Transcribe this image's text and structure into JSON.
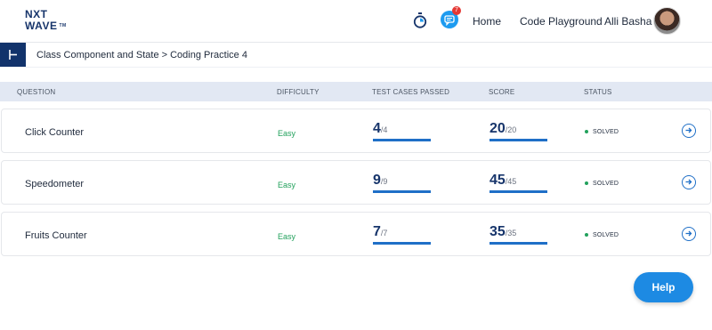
{
  "brand": {
    "line1": "NXT",
    "line2": "WAVE",
    "tm": "TM"
  },
  "nav": {
    "notification_count": "7",
    "home": "Home",
    "playground": "Code Playground",
    "user_name": "Alli Basha"
  },
  "breadcrumb": "Class Component and State > Coding Practice 4",
  "table": {
    "headers": [
      "QUESTION",
      "DIFFICULTY",
      "TEST CASES PASSED",
      "SCORE",
      "STATUS"
    ],
    "rows": [
      {
        "question": "Click Counter",
        "difficulty": "Easy",
        "tests_passed": "4",
        "tests_total": "/4",
        "score": "20",
        "score_total": "/20",
        "status": "SOLVED"
      },
      {
        "question": "Speedometer",
        "difficulty": "Easy",
        "tests_passed": "9",
        "tests_total": "/9",
        "score": "45",
        "score_total": "/45",
        "status": "SOLVED"
      },
      {
        "question": "Fruits Counter",
        "difficulty": "Easy",
        "tests_passed": "7",
        "tests_total": "/7",
        "score": "35",
        "score_total": "/35",
        "status": "SOLVED"
      }
    ]
  },
  "help_label": "Help",
  "colors": {
    "brand_navy": "#12336b",
    "accent_blue": "#1f6fc7",
    "success_green": "#22a15c",
    "help_blue": "#1d8ae3"
  },
  "icons": [
    "sidebar-toggle-icon",
    "timer-icon",
    "chat-icon",
    "arrow-right-circle-icon"
  ]
}
